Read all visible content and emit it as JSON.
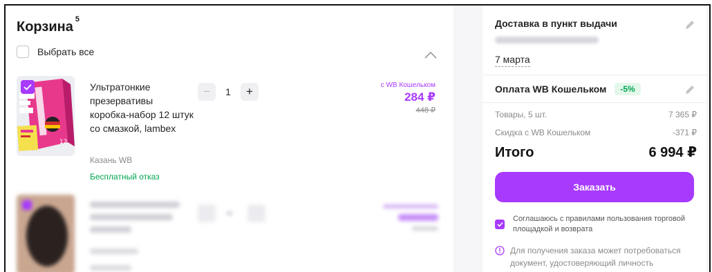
{
  "cart": {
    "title": "Корзина",
    "count": "5",
    "select_all_label": "Выбрать все",
    "items": [
      {
        "name": "Ультратонкие презервативы коробка-набор 12 штук со смазкой, lambex",
        "seller": "Казань WB",
        "refund_note": "Бесплатный отказ",
        "quantity": "1",
        "price_label": "с WB Кошельком",
        "price": "284 ₽",
        "old_price": "448 ₽",
        "selected": true
      }
    ]
  },
  "summary": {
    "delivery_title": "Доставка в пункт выдачи",
    "delivery_date": "7 марта",
    "payment_title": "Оплата WB Кошельком",
    "payment_badge": "-5%",
    "goods_label": "Товары, 5 шт.",
    "goods_value": "7 365 ₽",
    "discount_label": "Скидка с WB Кошельком",
    "discount_value": "-371 ₽",
    "total_label": "Итого",
    "total_value": "6 994 ₽",
    "order_button": "Заказать",
    "agree_text": "Соглашаюсь с правилами пользования торговой площадкой и возврата",
    "note_text": "Для получения заказа может потребоваться документ, удостоверяющий личность"
  },
  "colors": {
    "accent": "#a73afd",
    "success": "#00a651",
    "muted": "#8a8a8a"
  }
}
